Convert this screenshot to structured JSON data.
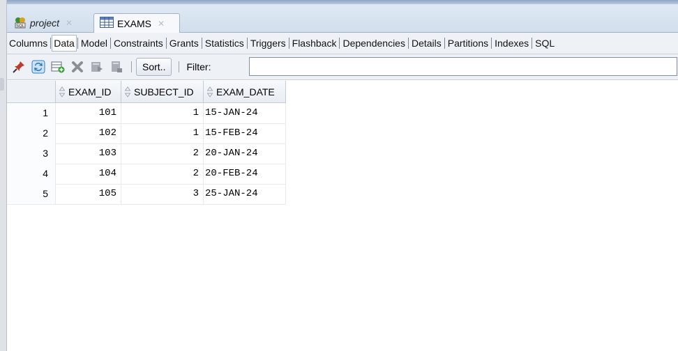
{
  "tabs": [
    {
      "label": "project",
      "icon": "sql-worksheet-icon",
      "active": false
    },
    {
      "label": "EXAMS",
      "icon": "table-icon",
      "active": true
    }
  ],
  "subtabs": [
    "Columns",
    "Data",
    "Model",
    "Constraints",
    "Grants",
    "Statistics",
    "Triggers",
    "Flashback",
    "Dependencies",
    "Details",
    "Partitions",
    "Indexes",
    "SQL"
  ],
  "active_subtab": "Data",
  "toolbar": {
    "icons": [
      "pin-icon",
      "refresh-icon",
      "insert-row-icon",
      "delete-row-icon",
      "commit-icon",
      "rollback-icon"
    ],
    "sort_label": "Sort..",
    "filter_label": "Filter:",
    "filter_value": ""
  },
  "grid": {
    "columns": [
      "EXAM_ID",
      "SUBJECT_ID",
      "EXAM_DATE"
    ],
    "rows": [
      {
        "n": "1",
        "exam_id": "101",
        "subject_id": "1",
        "exam_date": "15-JAN-24"
      },
      {
        "n": "2",
        "exam_id": "102",
        "subject_id": "1",
        "exam_date": "15-FEB-24"
      },
      {
        "n": "3",
        "exam_id": "103",
        "subject_id": "2",
        "exam_date": "20-JAN-24"
      },
      {
        "n": "4",
        "exam_id": "104",
        "subject_id": "2",
        "exam_date": "20-FEB-24"
      },
      {
        "n": "5",
        "exam_id": "105",
        "subject_id": "3",
        "exam_date": "25-JAN-24"
      }
    ]
  },
  "colors": {
    "accent": "#c0392b",
    "refresh": "#2e7bc6",
    "insert": "#3aa03a"
  }
}
